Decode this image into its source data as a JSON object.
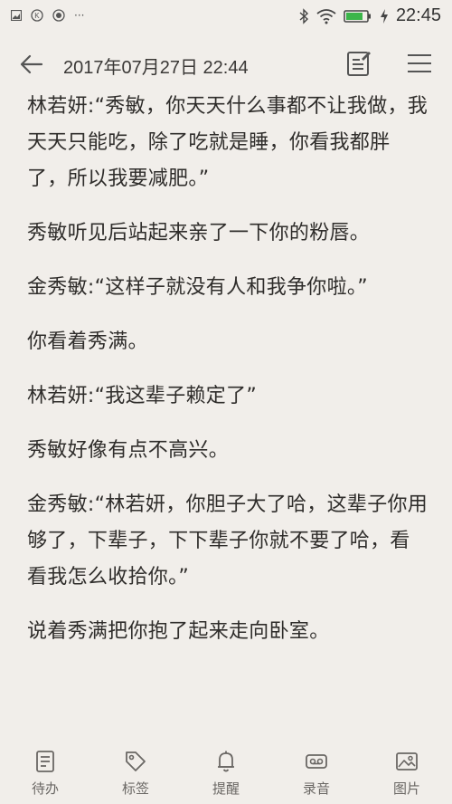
{
  "status_bar": {
    "time": "22:45",
    "more_dots": "···"
  },
  "header": {
    "title": "2017年07月27日 22:44"
  },
  "note": {
    "paragraphs": [
      "林若妍:“秀敏，你天天什么事都不让我做，我天天只能吃，除了吃就是睡，你看我都胖了，所以我要减肥。”",
      "秀敏听见后站起来亲了一下你的粉唇。",
      "金秀敏:“这样子就没有人和我争你啦。”",
      "你看着秀满。",
      "林若妍:“我这辈子赖定了”",
      "秀敏好像有点不高兴。",
      "金秀敏:“林若妍，你胆子大了哈，这辈子你用够了，下辈子，下下辈子你就不要了哈，看看我怎么收拾你。”",
      "说着秀满把你抱了起来走向卧室。"
    ]
  },
  "bottom_bar": {
    "items": [
      {
        "label": "待办",
        "icon": "todo-icon"
      },
      {
        "label": "标签",
        "icon": "tag-icon"
      },
      {
        "label": "提醒",
        "icon": "bell-icon"
      },
      {
        "label": "录音",
        "icon": "recorder-icon"
      },
      {
        "label": "图片",
        "icon": "image-icon"
      }
    ]
  }
}
